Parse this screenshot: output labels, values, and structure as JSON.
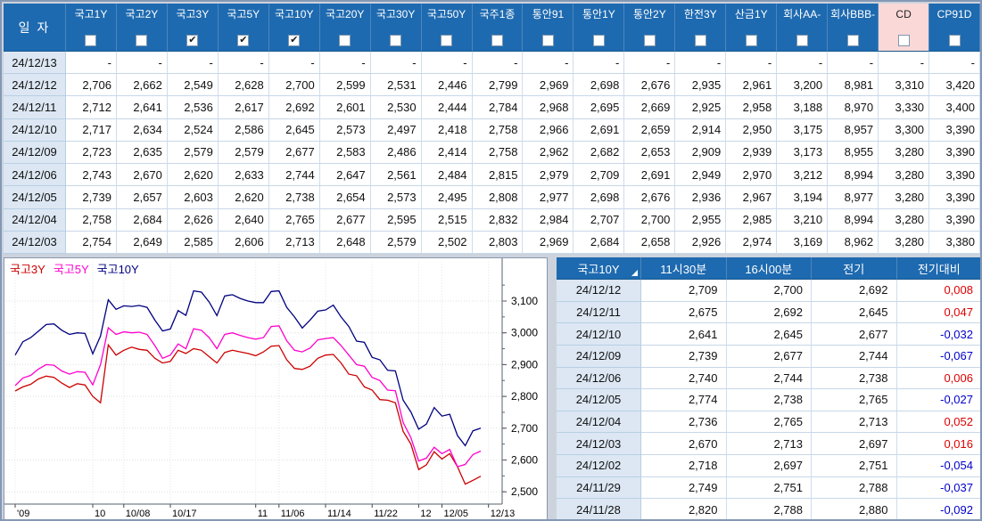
{
  "colors": {
    "header_bg": "#1e6ab0",
    "header_text": "#ffffff",
    "date_col_bg": "#dce7f3",
    "grid_line": "#b9cfe3",
    "cd_header_bg": "#fbd8d8",
    "positive": "#e00000",
    "negative": "#0000cc"
  },
  "main_table": {
    "date_header": "일 자",
    "empty_placeholder": "-",
    "columns": [
      {
        "label": "국고1Y",
        "checked": false
      },
      {
        "label": "국고2Y",
        "checked": false
      },
      {
        "label": "국고3Y",
        "checked": true
      },
      {
        "label": "국고5Y",
        "checked": true
      },
      {
        "label": "국고10Y",
        "checked": true
      },
      {
        "label": "국고20Y",
        "checked": false
      },
      {
        "label": "국고30Y",
        "checked": false
      },
      {
        "label": "국고50Y",
        "checked": false
      },
      {
        "label": "국주1종",
        "checked": false
      },
      {
        "label": "통안91",
        "checked": false
      },
      {
        "label": "통안1Y",
        "checked": false
      },
      {
        "label": "통안2Y",
        "checked": false
      },
      {
        "label": "한전3Y",
        "checked": false
      },
      {
        "label": "산금1Y",
        "checked": false
      },
      {
        "label": "회사AA-",
        "checked": false
      },
      {
        "label": "회사BBB-",
        "checked": false
      },
      {
        "label": "CD",
        "checked": false,
        "highlight": true
      },
      {
        "label": "CP91D",
        "checked": false
      }
    ],
    "rows": [
      {
        "date": "24/12/13",
        "values": [
          null,
          null,
          null,
          null,
          null,
          null,
          null,
          null,
          null,
          null,
          null,
          null,
          null,
          null,
          null,
          null,
          null,
          null
        ]
      },
      {
        "date": "24/12/12",
        "values": [
          2.706,
          2.662,
          2.549,
          2.628,
          2.7,
          2.599,
          2.531,
          2.446,
          2.799,
          2.969,
          2.698,
          2.676,
          2.935,
          2.961,
          3.2,
          8.981,
          3.31,
          3.42
        ]
      },
      {
        "date": "24/12/11",
        "values": [
          2.712,
          2.641,
          2.536,
          2.617,
          2.692,
          2.601,
          2.53,
          2.444,
          2.784,
          2.968,
          2.695,
          2.669,
          2.925,
          2.958,
          3.188,
          8.97,
          3.33,
          3.4
        ]
      },
      {
        "date": "24/12/10",
        "values": [
          2.717,
          2.634,
          2.524,
          2.586,
          2.645,
          2.573,
          2.497,
          2.418,
          2.758,
          2.966,
          2.691,
          2.659,
          2.914,
          2.95,
          3.175,
          8.957,
          3.3,
          3.39
        ]
      },
      {
        "date": "24/12/09",
        "values": [
          2.723,
          2.635,
          2.579,
          2.579,
          2.677,
          2.583,
          2.486,
          2.414,
          2.758,
          2.962,
          2.682,
          2.653,
          2.909,
          2.939,
          3.173,
          8.955,
          3.28,
          3.39
        ]
      },
      {
        "date": "24/12/06",
        "values": [
          2.743,
          2.67,
          2.62,
          2.633,
          2.744,
          2.647,
          2.561,
          2.484,
          2.815,
          2.979,
          2.709,
          2.691,
          2.949,
          2.97,
          3.212,
          8.994,
          3.28,
          3.39
        ]
      },
      {
        "date": "24/12/05",
        "values": [
          2.739,
          2.657,
          2.603,
          2.62,
          2.738,
          2.654,
          2.573,
          2.495,
          2.808,
          2.977,
          2.698,
          2.676,
          2.936,
          2.967,
          3.194,
          8.977,
          3.28,
          3.39
        ]
      },
      {
        "date": "24/12/04",
        "values": [
          2.758,
          2.684,
          2.626,
          2.64,
          2.765,
          2.677,
          2.595,
          2.515,
          2.832,
          2.984,
          2.707,
          2.7,
          2.955,
          2.985,
          3.21,
          8.994,
          3.28,
          3.39
        ]
      },
      {
        "date": "24/12/03",
        "values": [
          2.754,
          2.649,
          2.585,
          2.606,
          2.713,
          2.648,
          2.579,
          2.502,
          2.803,
          2.969,
          2.684,
          2.658,
          2.926,
          2.974,
          3.169,
          8.962,
          3.28,
          3.38
        ]
      }
    ]
  },
  "detail_table": {
    "headers": [
      "국고10Y",
      "11시30분",
      "16시00분",
      "전기",
      "전기대비"
    ],
    "sort_icon": "sort-corner-triangle-icon",
    "rows": [
      {
        "date": "24/12/12",
        "t1130": 2.709,
        "t1600": 2.7,
        "prev": 2.692,
        "change": 0.008
      },
      {
        "date": "24/12/11",
        "t1130": 2.675,
        "t1600": 2.692,
        "prev": 2.645,
        "change": 0.047
      },
      {
        "date": "24/12/10",
        "t1130": 2.641,
        "t1600": 2.645,
        "prev": 2.677,
        "change": -0.032
      },
      {
        "date": "24/12/09",
        "t1130": 2.739,
        "t1600": 2.677,
        "prev": 2.744,
        "change": -0.067
      },
      {
        "date": "24/12/06",
        "t1130": 2.74,
        "t1600": 2.744,
        "prev": 2.738,
        "change": 0.006
      },
      {
        "date": "24/12/05",
        "t1130": 2.774,
        "t1600": 2.738,
        "prev": 2.765,
        "change": -0.027
      },
      {
        "date": "24/12/04",
        "t1130": 2.736,
        "t1600": 2.765,
        "prev": 2.713,
        "change": 0.052
      },
      {
        "date": "24/12/03",
        "t1130": 2.67,
        "t1600": 2.713,
        "prev": 2.697,
        "change": 0.016
      },
      {
        "date": "24/12/02",
        "t1130": 2.718,
        "t1600": 2.697,
        "prev": 2.751,
        "change": -0.054
      },
      {
        "date": "24/11/29",
        "t1130": 2.749,
        "t1600": 2.751,
        "prev": 2.788,
        "change": -0.037
      },
      {
        "date": "24/11/28",
        "t1130": 2.82,
        "t1600": 2.788,
        "prev": 2.88,
        "change": -0.092
      }
    ]
  },
  "chart_data": {
    "type": "line",
    "title": "",
    "legend_position": "top-left",
    "y_axis_side": "right",
    "grid": true,
    "ylim": [
      2.45,
      3.22
    ],
    "y_ticks": [
      3.1,
      3.0,
      2.9,
      2.8,
      2.7,
      2.6,
      2.5
    ],
    "x_tick_labels": [
      {
        "label": "'09",
        "i": 0
      },
      {
        "label": "10",
        "i": 10
      },
      {
        "label": "10/08",
        "i": 14
      },
      {
        "label": "10/17",
        "i": 20
      },
      {
        "label": "11",
        "i": 31
      },
      {
        "label": "11/06",
        "i": 34
      },
      {
        "label": "11/14",
        "i": 40
      },
      {
        "label": "11/22",
        "i": 46
      },
      {
        "label": "12",
        "i": 52
      },
      {
        "label": "12/05",
        "i": 55
      },
      {
        "label": "12/13",
        "i": 61
      }
    ],
    "x": [
      "09/12",
      "09/13",
      "09/19",
      "09/20",
      "09/23",
      "09/24",
      "09/25",
      "09/26",
      "09/27",
      "09/30",
      "10/01",
      "10/02",
      "10/04",
      "10/07",
      "10/08",
      "10/10",
      "10/11",
      "10/14",
      "10/15",
      "10/16",
      "10/17",
      "10/18",
      "10/21",
      "10/22",
      "10/23",
      "10/24",
      "10/25",
      "10/28",
      "10/29",
      "10/30",
      "10/31",
      "11/01",
      "11/04",
      "11/05",
      "11/06",
      "11/07",
      "11/08",
      "11/11",
      "11/12",
      "11/13",
      "11/14",
      "11/15",
      "11/18",
      "11/19",
      "11/20",
      "11/21",
      "11/22",
      "11/25",
      "11/26",
      "11/27",
      "11/28",
      "11/29",
      "12/02",
      "12/03",
      "12/04",
      "12/05",
      "12/06",
      "12/09",
      "12/10",
      "12/11",
      "12/12"
    ],
    "series": [
      {
        "name": "국고3Y",
        "color": "#cc0000",
        "values": [
          2.817,
          2.83,
          2.838,
          2.855,
          2.864,
          2.86,
          2.842,
          2.828,
          2.84,
          2.836,
          2.8,
          2.78,
          2.962,
          2.93,
          2.945,
          2.955,
          2.948,
          2.945,
          2.92,
          2.905,
          2.91,
          2.945,
          2.935,
          2.95,
          2.945,
          2.925,
          2.905,
          2.938,
          2.945,
          2.94,
          2.935,
          2.928,
          2.94,
          2.958,
          2.96,
          2.915,
          2.888,
          2.885,
          2.895,
          2.92,
          2.93,
          2.932,
          2.905,
          2.87,
          2.865,
          2.83,
          2.82,
          2.79,
          2.788,
          2.78,
          2.69,
          2.65,
          2.57,
          2.585,
          2.626,
          2.603,
          2.62,
          2.579,
          2.524,
          2.536,
          2.549
        ]
      },
      {
        "name": "국고5Y",
        "color": "#ff00cc",
        "values": [
          2.834,
          2.858,
          2.866,
          2.886,
          2.9,
          2.898,
          2.88,
          2.87,
          2.878,
          2.876,
          2.836,
          2.9,
          3.016,
          2.995,
          3.003,
          3.0,
          3.002,
          2.995,
          2.96,
          2.92,
          2.93,
          2.965,
          2.95,
          3.013,
          3.008,
          2.985,
          2.95,
          2.995,
          3.0,
          2.992,
          2.985,
          2.98,
          2.985,
          3.02,
          3.022,
          2.975,
          2.945,
          2.94,
          2.952,
          2.978,
          2.982,
          2.985,
          2.96,
          2.93,
          2.9,
          2.895,
          2.86,
          2.85,
          2.82,
          2.818,
          2.718,
          2.67,
          2.597,
          2.606,
          2.64,
          2.62,
          2.633,
          2.579,
          2.586,
          2.617,
          2.628
        ]
      },
      {
        "name": "국고10Y",
        "color": "#000080",
        "values": [
          2.93,
          2.972,
          2.985,
          3.005,
          3.026,
          3.028,
          3.008,
          2.995,
          3.0,
          2.998,
          2.934,
          2.99,
          3.104,
          3.074,
          3.085,
          3.083,
          3.086,
          3.08,
          3.04,
          3.006,
          3.012,
          3.07,
          3.055,
          3.132,
          3.128,
          3.097,
          3.054,
          3.116,
          3.12,
          3.108,
          3.1,
          3.095,
          3.095,
          3.13,
          3.132,
          3.08,
          3.05,
          3.015,
          3.04,
          3.068,
          3.072,
          3.087,
          3.05,
          3.02,
          2.974,
          2.97,
          2.923,
          2.915,
          2.882,
          2.88,
          2.788,
          2.751,
          2.697,
          2.713,
          2.765,
          2.738,
          2.744,
          2.677,
          2.645,
          2.692,
          2.7
        ]
      }
    ]
  }
}
